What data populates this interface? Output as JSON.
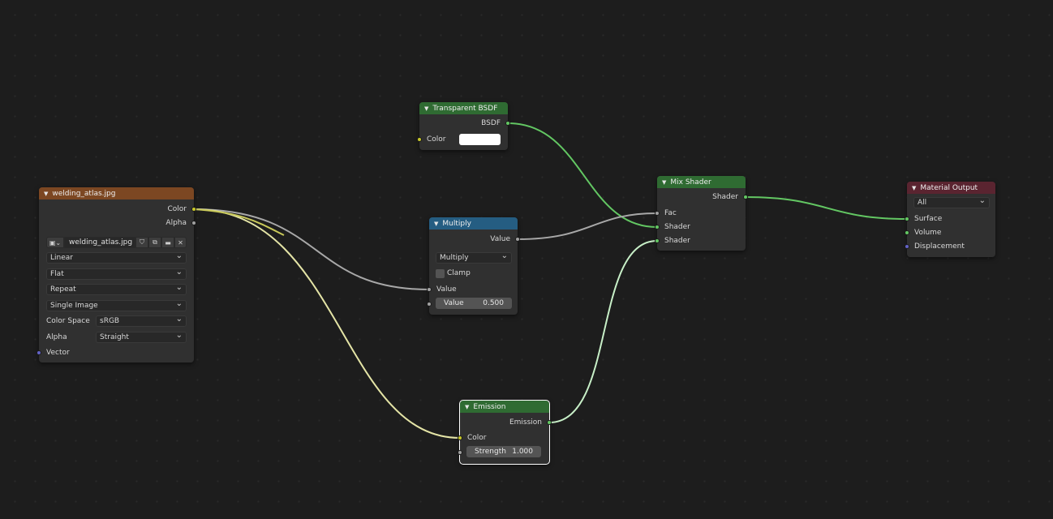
{
  "colors": {
    "shader": "#63c763",
    "color": "#c7c729",
    "float": "#a1a1a1",
    "vector": "#6363c7",
    "hdr_image": "#7c4722",
    "hdr_shader": "#2f6b32",
    "hdr_converter": "#255d82",
    "hdr_output": "#5a2430"
  },
  "nodes": {
    "image": {
      "title": "welding_atlas.jpg",
      "out_color": "Color",
      "out_alpha": "Alpha",
      "image_name": "welding_atlas.jpg",
      "interpolation": "Linear",
      "projection": "Flat",
      "extension": "Repeat",
      "source": "Single Image",
      "color_space_label": "Color Space",
      "color_space": "sRGB",
      "alpha_label": "Alpha",
      "alpha_mode": "Straight",
      "in_vector": "Vector"
    },
    "transparent": {
      "title": "Transparent BSDF",
      "out_bsdf": "BSDF",
      "in_color": "Color",
      "color_value": "#ffffff"
    },
    "multiply": {
      "title": "Multiply",
      "out_value": "Value",
      "operation": "Multiply",
      "clamp_label": "Clamp",
      "in_value1": "Value",
      "in_value2_label": "Value",
      "in_value2": "0.500"
    },
    "emission": {
      "title": "Emission",
      "out_emission": "Emission",
      "in_color": "Color",
      "strength_label": "Strength",
      "strength": "1.000"
    },
    "mix": {
      "title": "Mix Shader",
      "out_shader": "Shader",
      "in_fac": "Fac",
      "in_shader1": "Shader",
      "in_shader2": "Shader"
    },
    "output": {
      "title": "Material Output",
      "target": "All",
      "in_surface": "Surface",
      "in_volume": "Volume",
      "in_displacement": "Displacement"
    }
  }
}
